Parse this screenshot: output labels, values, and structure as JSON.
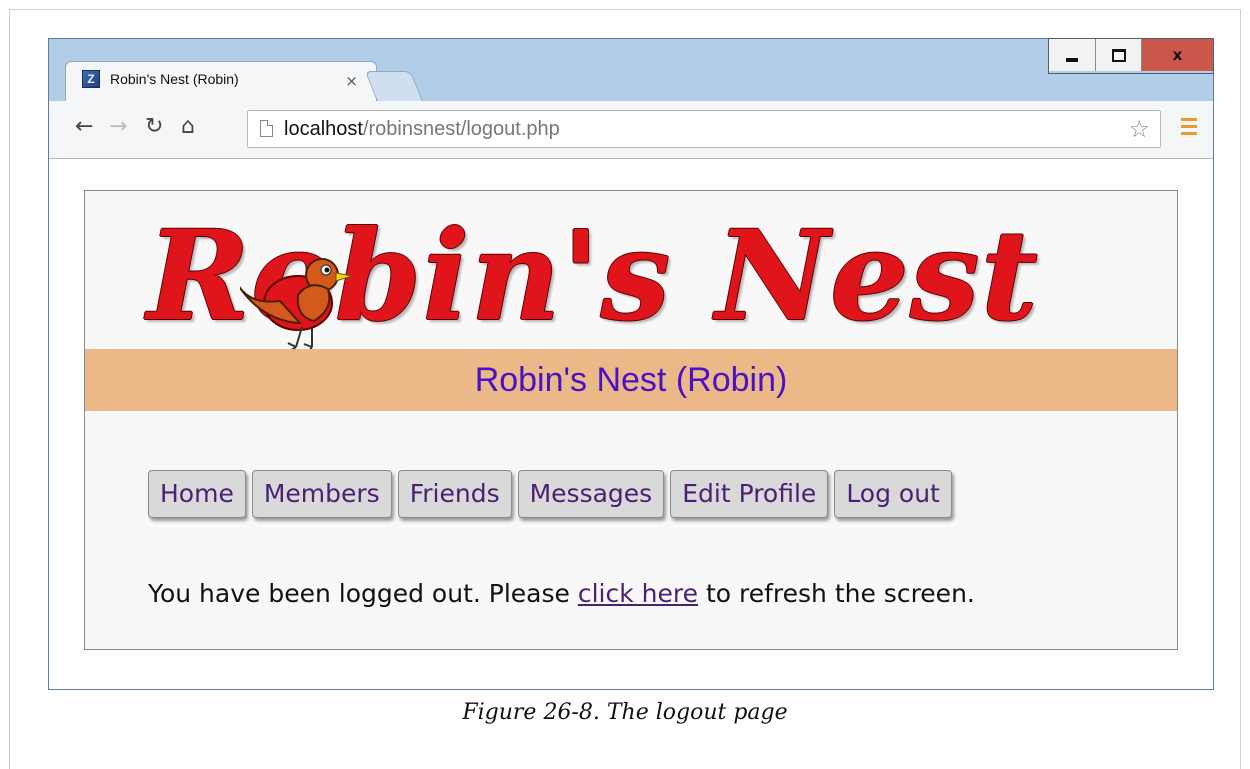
{
  "browser": {
    "tab_title": "Robin's Nest (Robin)",
    "tab_close": "×",
    "url_host": "localhost",
    "url_path": "/robinsnest/logout.php",
    "window_close": "x",
    "favicon_letter": "Z"
  },
  "site": {
    "logo_text": "Robin's Nest",
    "banner_text": "Robin's Nest (Robin)",
    "menu": [
      "Home",
      "Members",
      "Friends",
      "Messages",
      "Edit Profile",
      "Log out"
    ],
    "message_before": "You have been logged out. Please ",
    "message_link": "click here",
    "message_after": " to refresh the screen."
  },
  "caption": "Figure 26-8. The logout page",
  "colors": {
    "banner": "#ebb988",
    "banner_text": "#4a12c8",
    "logo": "#e0141b",
    "link": "#4b1f73"
  },
  "icons": [
    "back-icon",
    "forward-icon",
    "reload-icon",
    "home-icon",
    "page-icon",
    "star-icon",
    "menu-icon",
    "minimize-icon",
    "maximize-icon",
    "close-icon"
  ]
}
